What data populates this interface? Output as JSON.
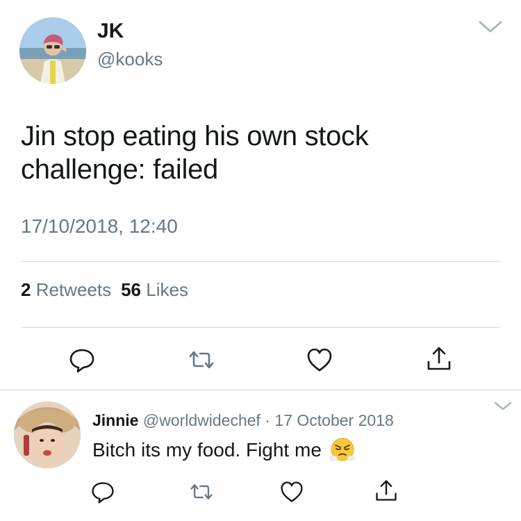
{
  "main_tweet": {
    "author_name": "JK",
    "author_handle": "@kooks",
    "text": "Jin stop eating his own stock\nchallenge: failed",
    "timestamp": "17/10/2018, 12:40",
    "stats": {
      "retweets_count": "2",
      "retweets_label": "Retweets",
      "likes_count": "56",
      "likes_label": "Likes"
    }
  },
  "reply": {
    "author_name": "Jinnie",
    "author_handle": "@worldwidechef",
    "separator": "·",
    "date": "17 October 2018",
    "text": "Bitch its my food. Fight me",
    "emoji": "face-with-steam-from-nose"
  },
  "icons": {
    "reply": "speech-bubble-icon",
    "retweet": "retweet-icon",
    "like": "heart-icon",
    "share": "share-icon",
    "more": "chevron-down-icon"
  },
  "colors": {
    "primary_text": "#14171a",
    "secondary_text": "#657786",
    "divider": "#cfd6dc",
    "icon_gray": "#657786"
  }
}
